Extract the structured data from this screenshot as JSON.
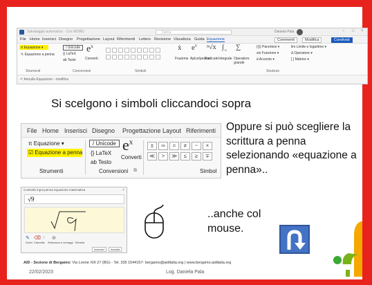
{
  "colors": {
    "frame": "#e8231d",
    "word_blue": "#185abd",
    "highlight": "#fff200",
    "pen_area": "#fdf9d8",
    "uturn": "#4472c4"
  },
  "ribbon": {
    "title_text": "Salvataggio automatico",
    "doc_name": "Con WORD",
    "search": "Cerca",
    "user": "Daniela Pala",
    "menu": [
      "File",
      "Home",
      "Inserisci",
      "Disegno",
      "Progettazione",
      "Layout",
      "Riferimenti",
      "Lettere",
      "Revisione",
      "Visualizza",
      "Guida",
      "Equazione"
    ],
    "comments": "Commenti",
    "edit": "Modifica",
    "share": "Condividi",
    "equazione": "Equazione",
    "equazione_penna": "Equazione a penna",
    "strumenti": "Strumenti",
    "unicode": "Unicode",
    "latex": "LaTeX",
    "testo": "ab Testo",
    "converti": "Converti",
    "conversioni": "Conversioni",
    "simboli": "Simboli",
    "struct_labels": [
      "Frazione",
      "Apice/pedice",
      "Radicale",
      "Integrale",
      "Operatore grande"
    ],
    "struct_right": [
      "Parentesi",
      "Funzione",
      "Accento",
      "Limite e logaritmo",
      "Operatore",
      "Matrice"
    ],
    "strutture": "Strutture",
    "status": "Annulla Equazione - modifica"
  },
  "caption": "Si scelgono i simboli cliccandoci sopra",
  "zoom": {
    "tabs": [
      "File",
      "Home",
      "Inserisci",
      "Disegno",
      "Progettazione",
      "Layout",
      "Riferimenti"
    ],
    "equazione": "Equazione",
    "equazione_penna": "Equazione a penna",
    "strumenti": "Strumenti",
    "unicode": "Unicode",
    "latex": "LaTeX",
    "testo": "Testo",
    "converti": "Converti",
    "conversioni": "Conversioni",
    "simboli": "Simbol"
  },
  "side_text": "Oppure si può scegliere la scrittura a penna selezionando «equazione a penna»..",
  "pen": {
    "title": "Controllo input penna equazione matematica",
    "preview": "√9",
    "written": "√9",
    "tools": [
      "Scrivi",
      "Cancella",
      "Seleziona e correggi",
      "Elimina"
    ],
    "insert": "Inserisci",
    "cancel": "Annulla"
  },
  "mouse_text": "..anche col mouse.",
  "footer": {
    "org": "AID - Sezione di Bergamo:",
    "details": "Via Leone XIII 27 (BG) - Tel. 335 1544157- bergamo@aiditalia.org | www.bergamo.aiditalia.org",
    "date": "22/02/2023",
    "author": "Log. Daniela Pala"
  }
}
